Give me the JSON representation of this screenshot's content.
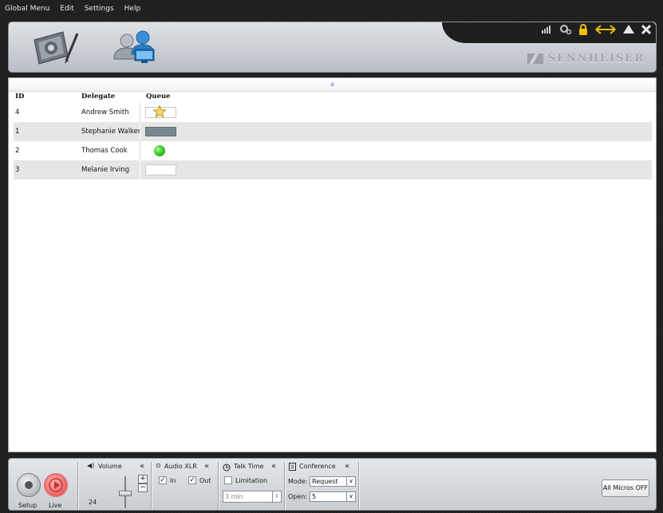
{
  "menu": [
    "Global Menu",
    "Edit",
    "Settings",
    "Help"
  ],
  "brand": "SENNHEISER",
  "sort_indicator": "a",
  "table": {
    "headers": {
      "id": "ID",
      "delegate": "Delegate",
      "queue": "Queue"
    },
    "rows": [
      {
        "id": "4",
        "delegate": "Andrew Smith",
        "queue": "star-icon"
      },
      {
        "id": "1",
        "delegate": "Stephanie Walker",
        "queue": "bar"
      },
      {
        "id": "2",
        "delegate": "Thomas Cook",
        "queue": "green-dot-icon"
      },
      {
        "id": "3",
        "delegate": "Melanie Irving",
        "queue": "empty"
      }
    ]
  },
  "bottom": {
    "setup_label": "Setup",
    "live_label": "Live",
    "volume_title": "Volume",
    "volume_value": "24",
    "audio_title": "Audio XLR",
    "audio_in": "In",
    "audio_out": "Out",
    "talk_title": "Talk Time",
    "limitation": "Limitation",
    "talk_value": "3 min",
    "conf_title": "Conference",
    "mode_label": "Mode:",
    "mode_value": "Request",
    "open_label": "Open:",
    "open_value": "5",
    "all_micros": "All Micros OFF",
    "collapse": "«"
  },
  "colors": {
    "accent": "#f0c000",
    "live": "#e04848",
    "green": "#3dcc2a"
  }
}
